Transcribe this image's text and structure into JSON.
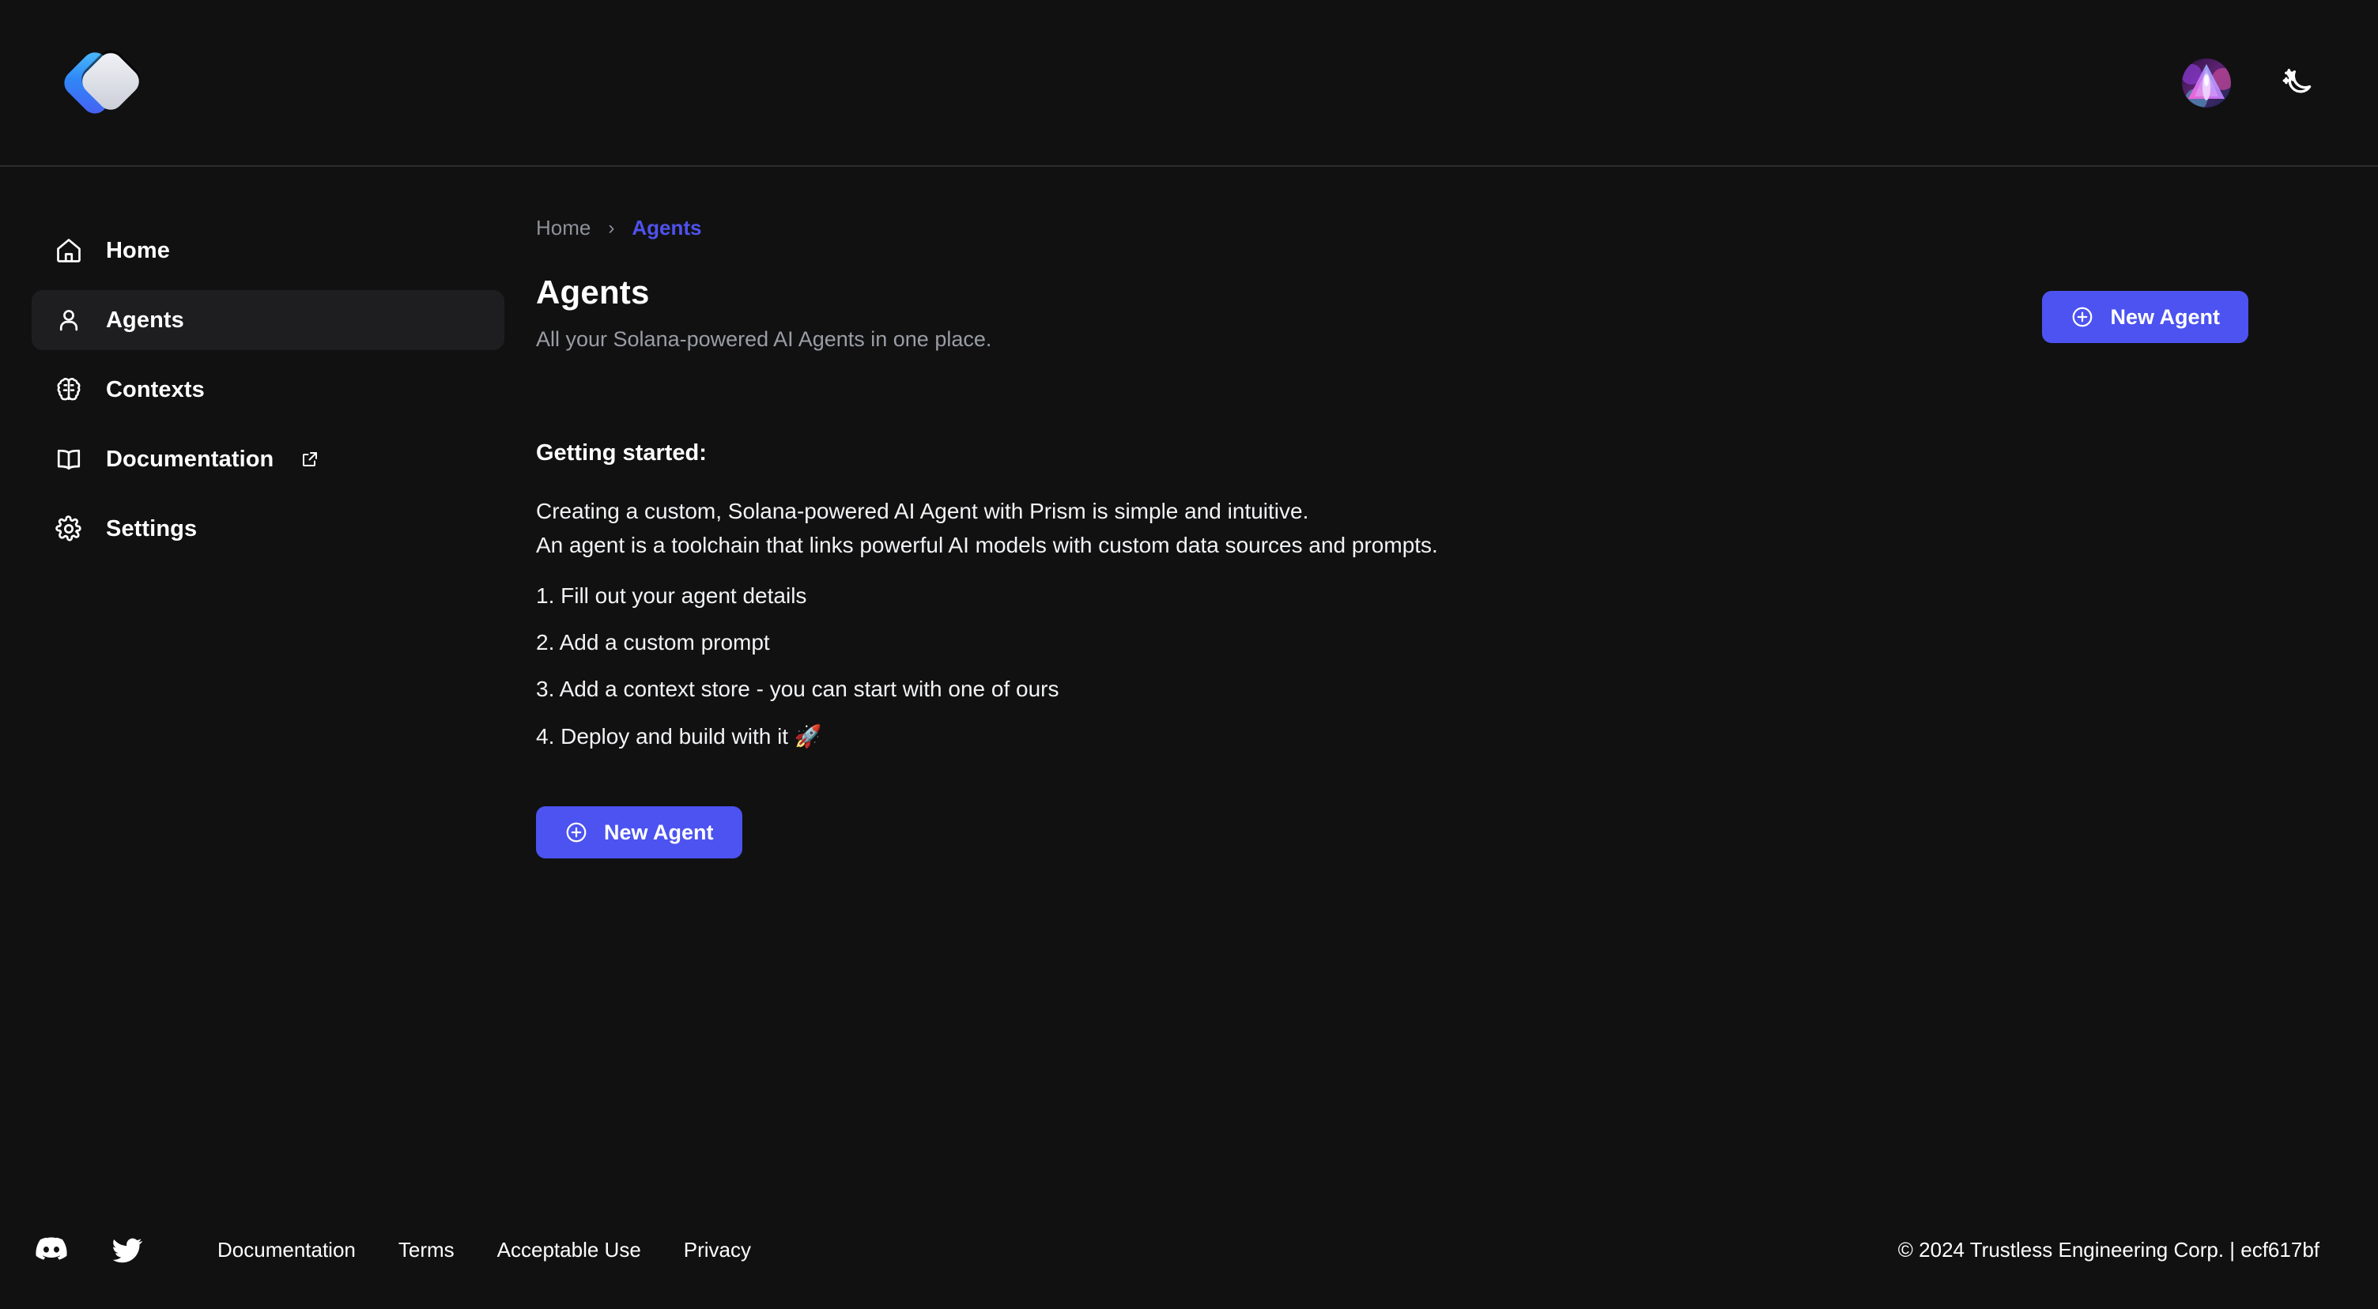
{
  "header": {
    "logo_name": "prism-logo",
    "avatar_name": "user-avatar",
    "theme_toggle_label": "Dark mode",
    "theme_icon": "moon-stars-icon"
  },
  "sidebar": {
    "items": [
      {
        "label": "Home",
        "icon": "home-icon",
        "active": false,
        "external": false
      },
      {
        "label": "Agents",
        "icon": "person-icon",
        "active": true,
        "external": false
      },
      {
        "label": "Contexts",
        "icon": "brain-icon",
        "active": false,
        "external": false
      },
      {
        "label": "Documentation",
        "icon": "book-icon",
        "active": false,
        "external": true
      },
      {
        "label": "Settings",
        "icon": "gear-icon",
        "active": false,
        "external": false
      }
    ]
  },
  "breadcrumb": {
    "home": "Home",
    "separator": "›",
    "current": "Agents"
  },
  "main": {
    "title": "Agents",
    "subtitle": "All your Solana-powered AI Agents in one place.",
    "new_agent_label": "New Agent",
    "new_agent_icon": "plus-circle-icon",
    "getting_started_heading": "Getting started:",
    "intro_line_1": "Creating a custom, Solana-powered AI Agent with Prism is simple and intuitive.",
    "intro_line_2": "An agent is a toolchain that links powerful AI models with custom data sources and prompts.",
    "steps": [
      "1. Fill out your agent details",
      "2. Add a custom prompt",
      "3. Add a context store - you can start with one of ours",
      "4. Deploy and build with it 🚀"
    ],
    "secondary_new_agent_label": "New Agent"
  },
  "footer": {
    "social": [
      {
        "name": "discord-icon",
        "label": "Discord"
      },
      {
        "name": "twitter-icon",
        "label": "Twitter"
      }
    ],
    "links": [
      "Documentation",
      "Terms",
      "Acceptable Use",
      "Privacy"
    ],
    "copyright": "© 2024 Trustless Engineering Corp. | ecf617bf"
  },
  "colors": {
    "page_bg": "#111112",
    "accent": "#4c53f0",
    "breadcrumb_accent": "#4f52ec",
    "active_item_bg": "#1e1e20",
    "muted_text": "#9a9da4",
    "border": "#2c2c2e"
  }
}
